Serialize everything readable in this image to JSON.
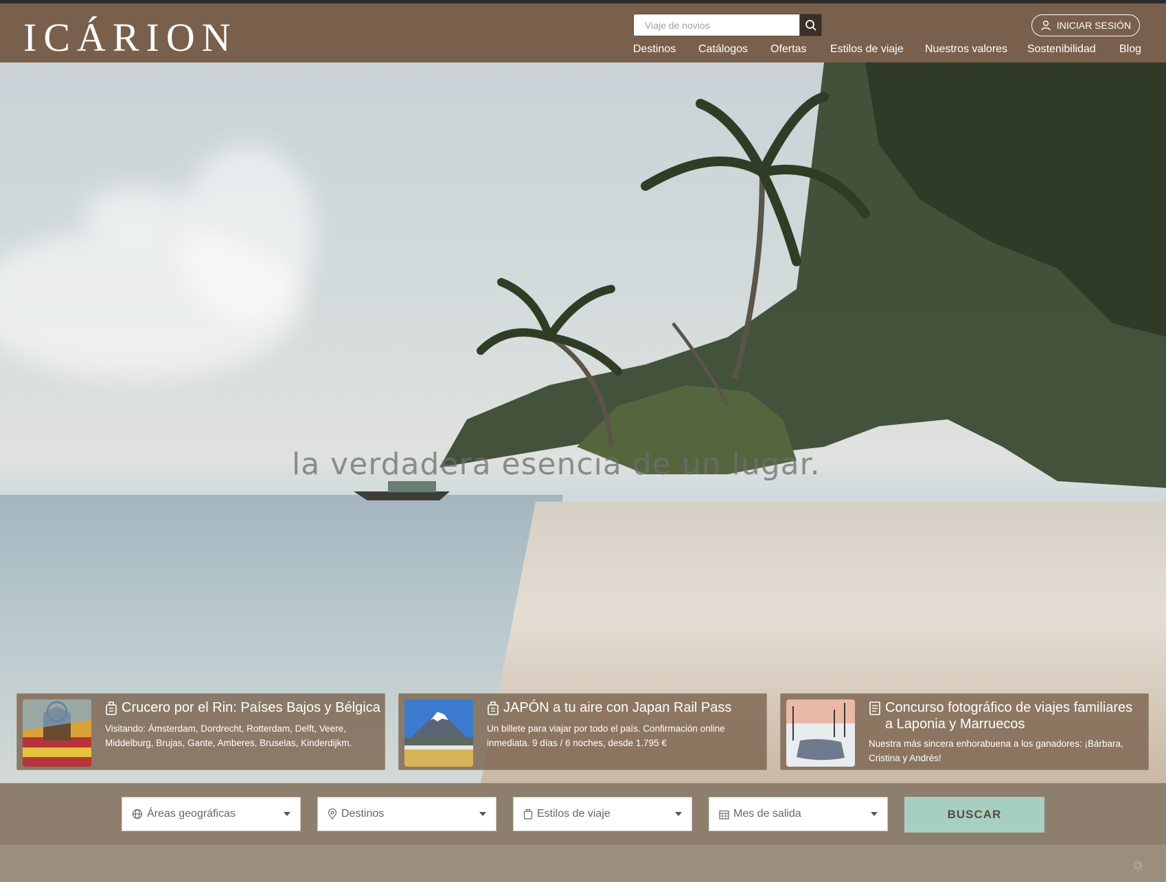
{
  "header": {
    "logo_text": "ICÁRION",
    "search_placeholder": "Viaje de novios",
    "login_label": "INICIAR SESIÓN",
    "nav": [
      "Destinos",
      "Catálogos",
      "Ofertas",
      "Estilos de viaje",
      "Nuestros valores",
      "Sostenibilidad",
      "Blog"
    ]
  },
  "hero": {
    "overlay_text": "la verdadera esencia de un lugar."
  },
  "cards": [
    {
      "icon": "luggage-icon",
      "title": "Crucero por el Rin: Países Bajos y Bélgica",
      "desc": "Visitando: Ámsterdam, Dordrecht, Rotterdam, Delft, Veere, Middelburg, Brujas, Gante, Amberes, Bruselas, Kinderdijkm."
    },
    {
      "icon": "luggage-icon",
      "title": "JAPÓN a tu aire con Japan Rail Pass",
      "desc": "Un billete para viajar por todo el país. Confirmación online inmediata. 9 días / 6 noches, desde 1.795 €"
    },
    {
      "icon": "document-icon",
      "title": "Concurso fotográfico de viajes familiares a Laponia y Marruecos",
      "desc": "Nuestra más sincera enhorabuena a los ganadores: ¡Bárbara, Cristina y Andrés!"
    }
  ],
  "filters": {
    "areas": "Áreas geográficas",
    "destinos": "Destinos",
    "estilos": "Estilos de viaje",
    "mes": "Mes de salida",
    "buscar": "BUSCAR"
  },
  "colors": {
    "header_bg": "#79604c",
    "button_accent": "#a7cfc1"
  }
}
